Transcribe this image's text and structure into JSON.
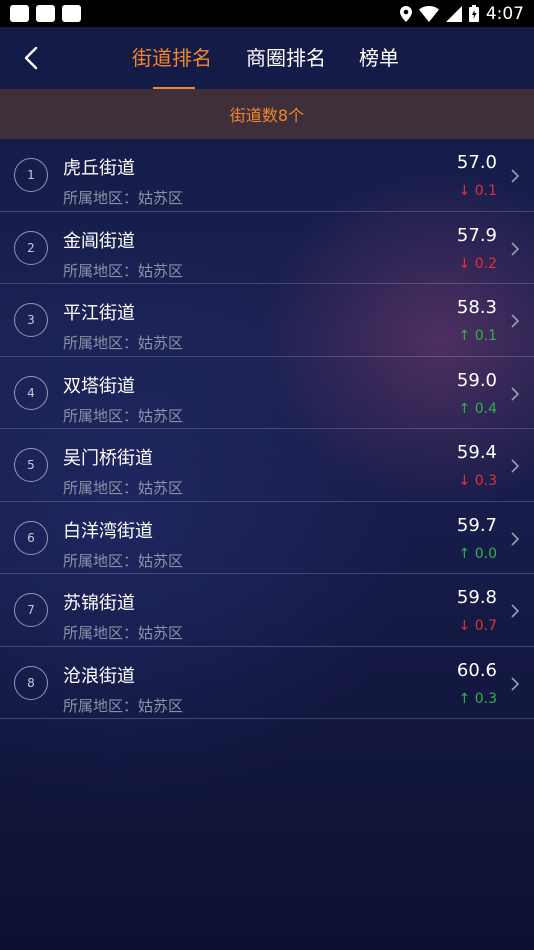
{
  "status_bar": {
    "time": "4:07"
  },
  "header": {
    "tabs": [
      {
        "label": "街道排名",
        "active": true
      },
      {
        "label": "商圈排名",
        "active": false
      },
      {
        "label": "榜单",
        "active": false
      }
    ]
  },
  "summary": {
    "count_text": "街道数8个"
  },
  "colors": {
    "accent": "#f0862c",
    "down": "#e0303a",
    "up": "#2fb24a"
  },
  "streets": [
    {
      "rank": "1",
      "name": "虎丘街道",
      "region": "所属地区：姑苏区",
      "score": "57.0",
      "change": "↓ 0.1",
      "direction": "down"
    },
    {
      "rank": "2",
      "name": "金阊街道",
      "region": "所属地区：姑苏区",
      "score": "57.9",
      "change": "↓ 0.2",
      "direction": "down"
    },
    {
      "rank": "3",
      "name": "平江街道",
      "region": "所属地区：姑苏区",
      "score": "58.3",
      "change": "↑ 0.1",
      "direction": "up"
    },
    {
      "rank": "4",
      "name": "双塔街道",
      "region": "所属地区：姑苏区",
      "score": "59.0",
      "change": "↑ 0.4",
      "direction": "up"
    },
    {
      "rank": "5",
      "name": "吴门桥街道",
      "region": "所属地区：姑苏区",
      "score": "59.4",
      "change": "↓ 0.3",
      "direction": "down"
    },
    {
      "rank": "6",
      "name": "白洋湾街道",
      "region": "所属地区：姑苏区",
      "score": "59.7",
      "change": "↑ 0.0",
      "direction": "up"
    },
    {
      "rank": "7",
      "name": "苏锦街道",
      "region": "所属地区：姑苏区",
      "score": "59.8",
      "change": "↓ 0.7",
      "direction": "down"
    },
    {
      "rank": "8",
      "name": "沧浪街道",
      "region": "所属地区：姑苏区",
      "score": "60.6",
      "change": "↑ 0.3",
      "direction": "up"
    }
  ]
}
